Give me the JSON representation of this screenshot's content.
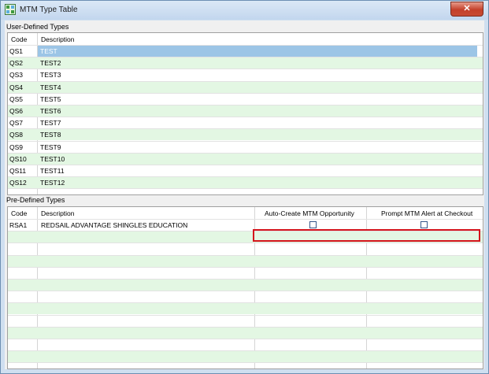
{
  "window": {
    "title": "MTM Type Table",
    "close_label": "✕"
  },
  "user_defined": {
    "section_label": "User-Defined Types",
    "columns": {
      "code": "Code",
      "description": "Description"
    },
    "rows": [
      {
        "code": "QS1",
        "description": "TEST"
      },
      {
        "code": "QS2",
        "description": "TEST2"
      },
      {
        "code": "QS3",
        "description": "TEST3"
      },
      {
        "code": "QS4",
        "description": "TEST4"
      },
      {
        "code": "QS5",
        "description": "TEST5"
      },
      {
        "code": "QS6",
        "description": "TEST6"
      },
      {
        "code": "QS7",
        "description": "TEST7"
      },
      {
        "code": "QS8",
        "description": "TEST8"
      },
      {
        "code": "QS9",
        "description": "TEST9"
      },
      {
        "code": "QS10",
        "description": "TEST10"
      },
      {
        "code": "QS11",
        "description": "TEST11"
      },
      {
        "code": "QS12",
        "description": "TEST12"
      }
    ]
  },
  "pre_defined": {
    "section_label": "Pre-Defined Types",
    "columns": {
      "code": "Code",
      "description": "Description",
      "auto_create": "Auto-Create MTM Opportunity",
      "prompt_alert": "Prompt MTM Alert at Checkout"
    },
    "rows": [
      {
        "code": "RSA1",
        "description": "REDSAIL ADVANTAGE SHINGLES EDUCATION",
        "auto_create": false,
        "prompt_alert": false
      }
    ]
  },
  "colors": {
    "alt_row": "#e3f7e3",
    "selected_row": "#9cc5e6",
    "highlight": "#d4141c"
  }
}
